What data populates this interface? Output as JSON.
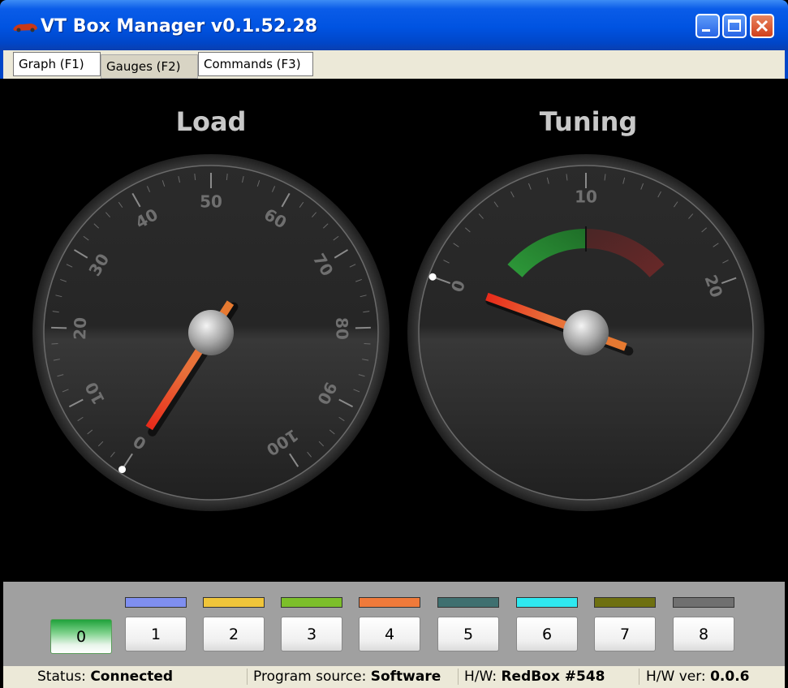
{
  "window": {
    "title": "VT Box Manager v0.1.52.28"
  },
  "tabs": [
    {
      "label": "Graph (F1)",
      "active": false
    },
    {
      "label": "Gauges (F2)",
      "active": true
    },
    {
      "label": "Commands (F3)",
      "active": false
    }
  ],
  "gauges": {
    "load": {
      "title": "Load",
      "min": 0,
      "max": 100,
      "tick_labels": [
        "0",
        "10",
        "20",
        "30",
        "40",
        "50",
        "60",
        "70",
        "80",
        "90",
        "100"
      ],
      "value": 0
    },
    "tuning": {
      "title": "Tuning",
      "min": 0,
      "max": 20,
      "tick_labels": [
        "0",
        "10",
        "20"
      ],
      "value": 0,
      "green_band": [
        3,
        10
      ],
      "red_band": [
        10,
        17
      ]
    }
  },
  "channels": [
    {
      "label": "0",
      "color": null,
      "active": true
    },
    {
      "label": "1",
      "color": "#7f8ff0"
    },
    {
      "label": "2",
      "color": "#f0c53a"
    },
    {
      "label": "3",
      "color": "#7cbf2a"
    },
    {
      "label": "4",
      "color": "#f07a3a"
    },
    {
      "label": "5",
      "color": "#3f7070"
    },
    {
      "label": "6",
      "color": "#2fe8f0"
    },
    {
      "label": "7",
      "color": "#6e7010"
    },
    {
      "label": "8",
      "color": "#707070"
    }
  ],
  "status": {
    "status_label": "Status:",
    "status_value": "Connected",
    "source_label": "Program source:",
    "source_value": "Software",
    "hw_label": "H/W:",
    "hw_value": "RedBox #548",
    "hwver_label": "H/W ver:",
    "hwver_value": "0.0.6"
  },
  "colors": {
    "titlebar": "#0053e1",
    "needle_tip": "#e82a1a",
    "needle_base": "#e67a30",
    "green_band": "#3ca84a",
    "red_band": "#6e2a2a"
  }
}
